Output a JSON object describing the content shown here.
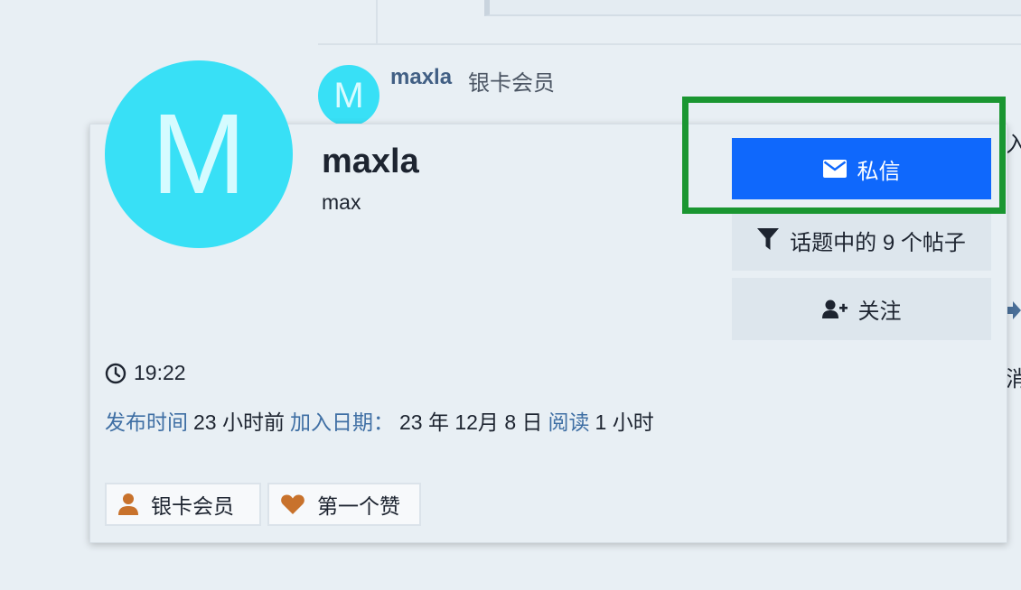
{
  "post": {
    "avatar_letter": "M",
    "author": "maxla",
    "user_title": "银卡会员"
  },
  "card": {
    "avatar_letter": "M",
    "username": "maxla",
    "name": "max",
    "buttons": {
      "message": "私信",
      "filter": "话题中的 9 个帖子",
      "follow": "关注"
    },
    "local_time": "19:22",
    "meta": {
      "posted_label": "发布时间",
      "posted_value": "23 小时前",
      "joined_label": "加入日期：",
      "joined_value": "23 年 12月 8 日",
      "read_label": "阅读",
      "read_value": "1 小时"
    },
    "badges": [
      {
        "label": "银卡会员",
        "icon": "user-icon"
      },
      {
        "label": "第一个赞",
        "icon": "heart-icon"
      }
    ]
  },
  "edge_fragments": {
    "top": "入",
    "bottom": "消"
  },
  "colors": {
    "accent": "#0f68fc",
    "highlight": "#1a9631",
    "avatar": "#38e0f6",
    "badge_icon": "#c8722c",
    "link": "#3f6fa4"
  }
}
